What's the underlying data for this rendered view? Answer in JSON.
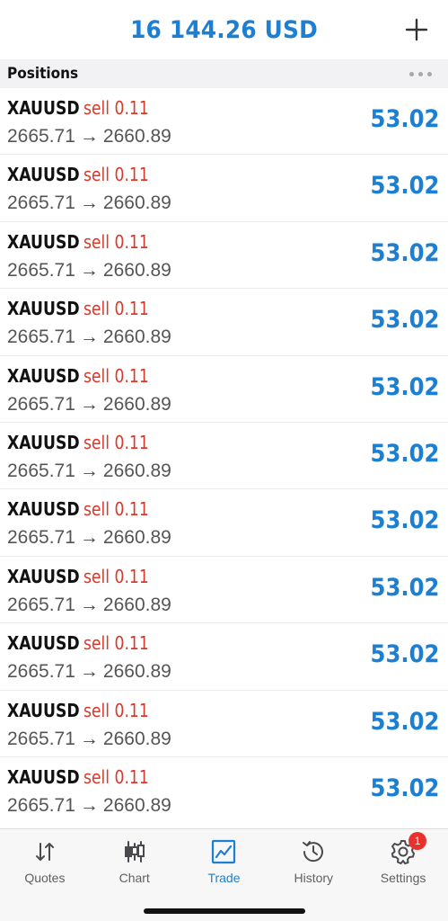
{
  "header": {
    "balance": "16 144.26 USD",
    "add_icon": "plus-icon"
  },
  "section": {
    "title": "Positions",
    "more_icon": "more-horizontal-icon"
  },
  "positions": [
    {
      "symbol": "XAUUSD",
      "side": "sell",
      "volume": "0.11",
      "open_price": "2665.71",
      "current_price": "2660.89",
      "profit": "53.02"
    },
    {
      "symbol": "XAUUSD",
      "side": "sell",
      "volume": "0.11",
      "open_price": "2665.71",
      "current_price": "2660.89",
      "profit": "53.02"
    },
    {
      "symbol": "XAUUSD",
      "side": "sell",
      "volume": "0.11",
      "open_price": "2665.71",
      "current_price": "2660.89",
      "profit": "53.02"
    },
    {
      "symbol": "XAUUSD",
      "side": "sell",
      "volume": "0.11",
      "open_price": "2665.71",
      "current_price": "2660.89",
      "profit": "53.02"
    },
    {
      "symbol": "XAUUSD",
      "side": "sell",
      "volume": "0.11",
      "open_price": "2665.71",
      "current_price": "2660.89",
      "profit": "53.02"
    },
    {
      "symbol": "XAUUSD",
      "side": "sell",
      "volume": "0.11",
      "open_price": "2665.71",
      "current_price": "2660.89",
      "profit": "53.02"
    },
    {
      "symbol": "XAUUSD",
      "side": "sell",
      "volume": "0.11",
      "open_price": "2665.71",
      "current_price": "2660.89",
      "profit": "53.02"
    },
    {
      "symbol": "XAUUSD",
      "side": "sell",
      "volume": "0.11",
      "open_price": "2665.71",
      "current_price": "2660.89",
      "profit": "53.02"
    },
    {
      "symbol": "XAUUSD",
      "side": "sell",
      "volume": "0.11",
      "open_price": "2665.71",
      "current_price": "2660.89",
      "profit": "53.02"
    },
    {
      "symbol": "XAUUSD",
      "side": "sell",
      "volume": "0.11",
      "open_price": "2665.71",
      "current_price": "2660.89",
      "profit": "53.02"
    },
    {
      "symbol": "XAUUSD",
      "side": "sell",
      "volume": "0.11",
      "open_price": "2665.71",
      "current_price": "2660.89",
      "profit": "53.02"
    }
  ],
  "tabs": [
    {
      "label": "Quotes",
      "icon": "quotes-arrows-icon",
      "active": false
    },
    {
      "label": "Chart",
      "icon": "candlestick-chart-icon",
      "active": false
    },
    {
      "label": "Trade",
      "icon": "trade-chart-icon",
      "active": true
    },
    {
      "label": "History",
      "icon": "history-clock-icon",
      "active": false
    },
    {
      "label": "Settings",
      "icon": "gear-icon",
      "active": false,
      "badge": "1"
    }
  ],
  "colors": {
    "accent": "#1c7fd1",
    "sell": "#d8392b",
    "badge": "#e8322e"
  }
}
